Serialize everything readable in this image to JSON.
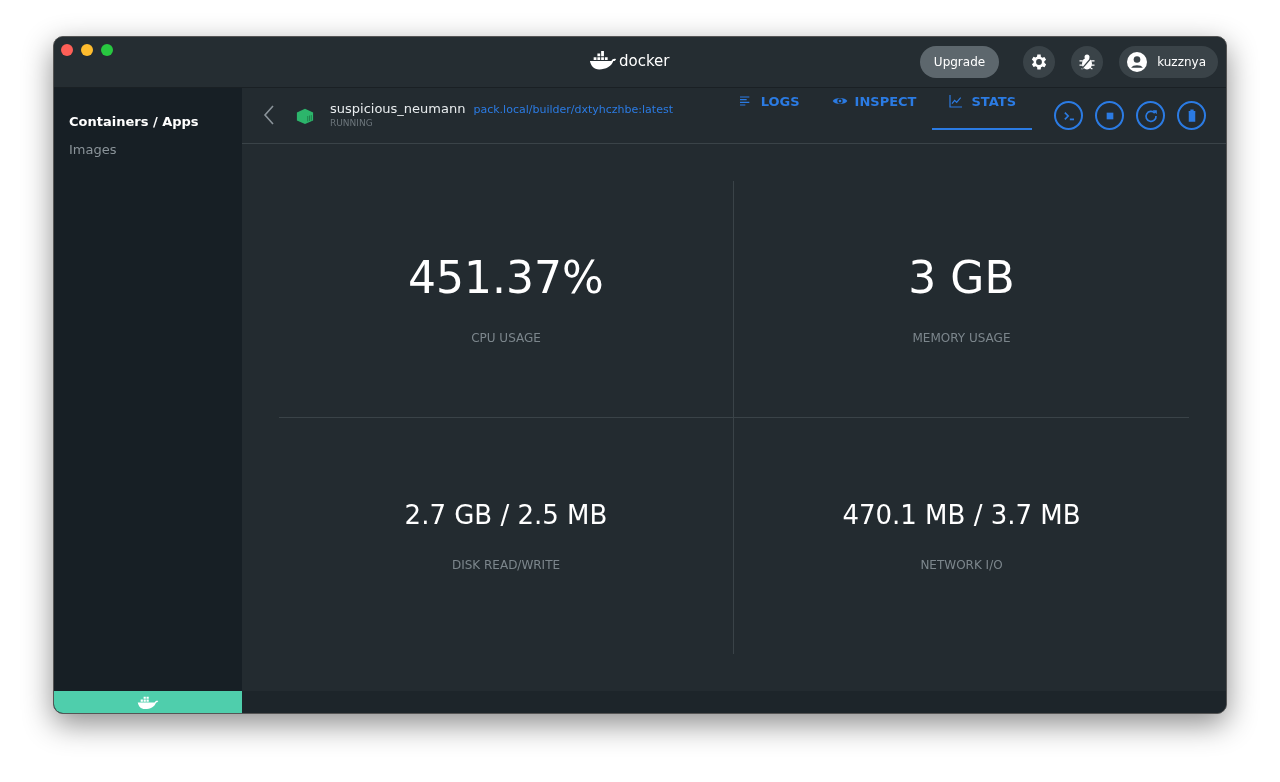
{
  "window": {
    "logo": "docker"
  },
  "toolbar": {
    "upgrade": "Upgrade",
    "user": "kuzznya"
  },
  "sidebar": {
    "items": [
      {
        "label": "Containers / Apps",
        "selected": true
      },
      {
        "label": "Images",
        "selected": false
      }
    ]
  },
  "container": {
    "name": "suspicious_neumann",
    "image": "pack.local/builder/dxtyhczhbe:latest",
    "status": "RUNNING"
  },
  "tabs": [
    {
      "label": "LOGS",
      "kind": "logs",
      "selected": false
    },
    {
      "label": "INSPECT",
      "kind": "inspect",
      "selected": false
    },
    {
      "label": "STATS",
      "kind": "stats",
      "selected": true
    }
  ],
  "actions": [
    {
      "kind": "cli"
    },
    {
      "kind": "stop"
    },
    {
      "kind": "restart"
    },
    {
      "kind": "delete"
    }
  ],
  "stats": [
    {
      "value": "451.37%",
      "label": "CPU USAGE"
    },
    {
      "value": "3 GB",
      "label": "MEMORY USAGE"
    },
    {
      "value": "2.7 GB / 2.5 MB",
      "label": "DISK READ/WRITE"
    },
    {
      "value": "470.1 MB / 3.7 MB",
      "label": "NETWORK I/O"
    }
  ]
}
